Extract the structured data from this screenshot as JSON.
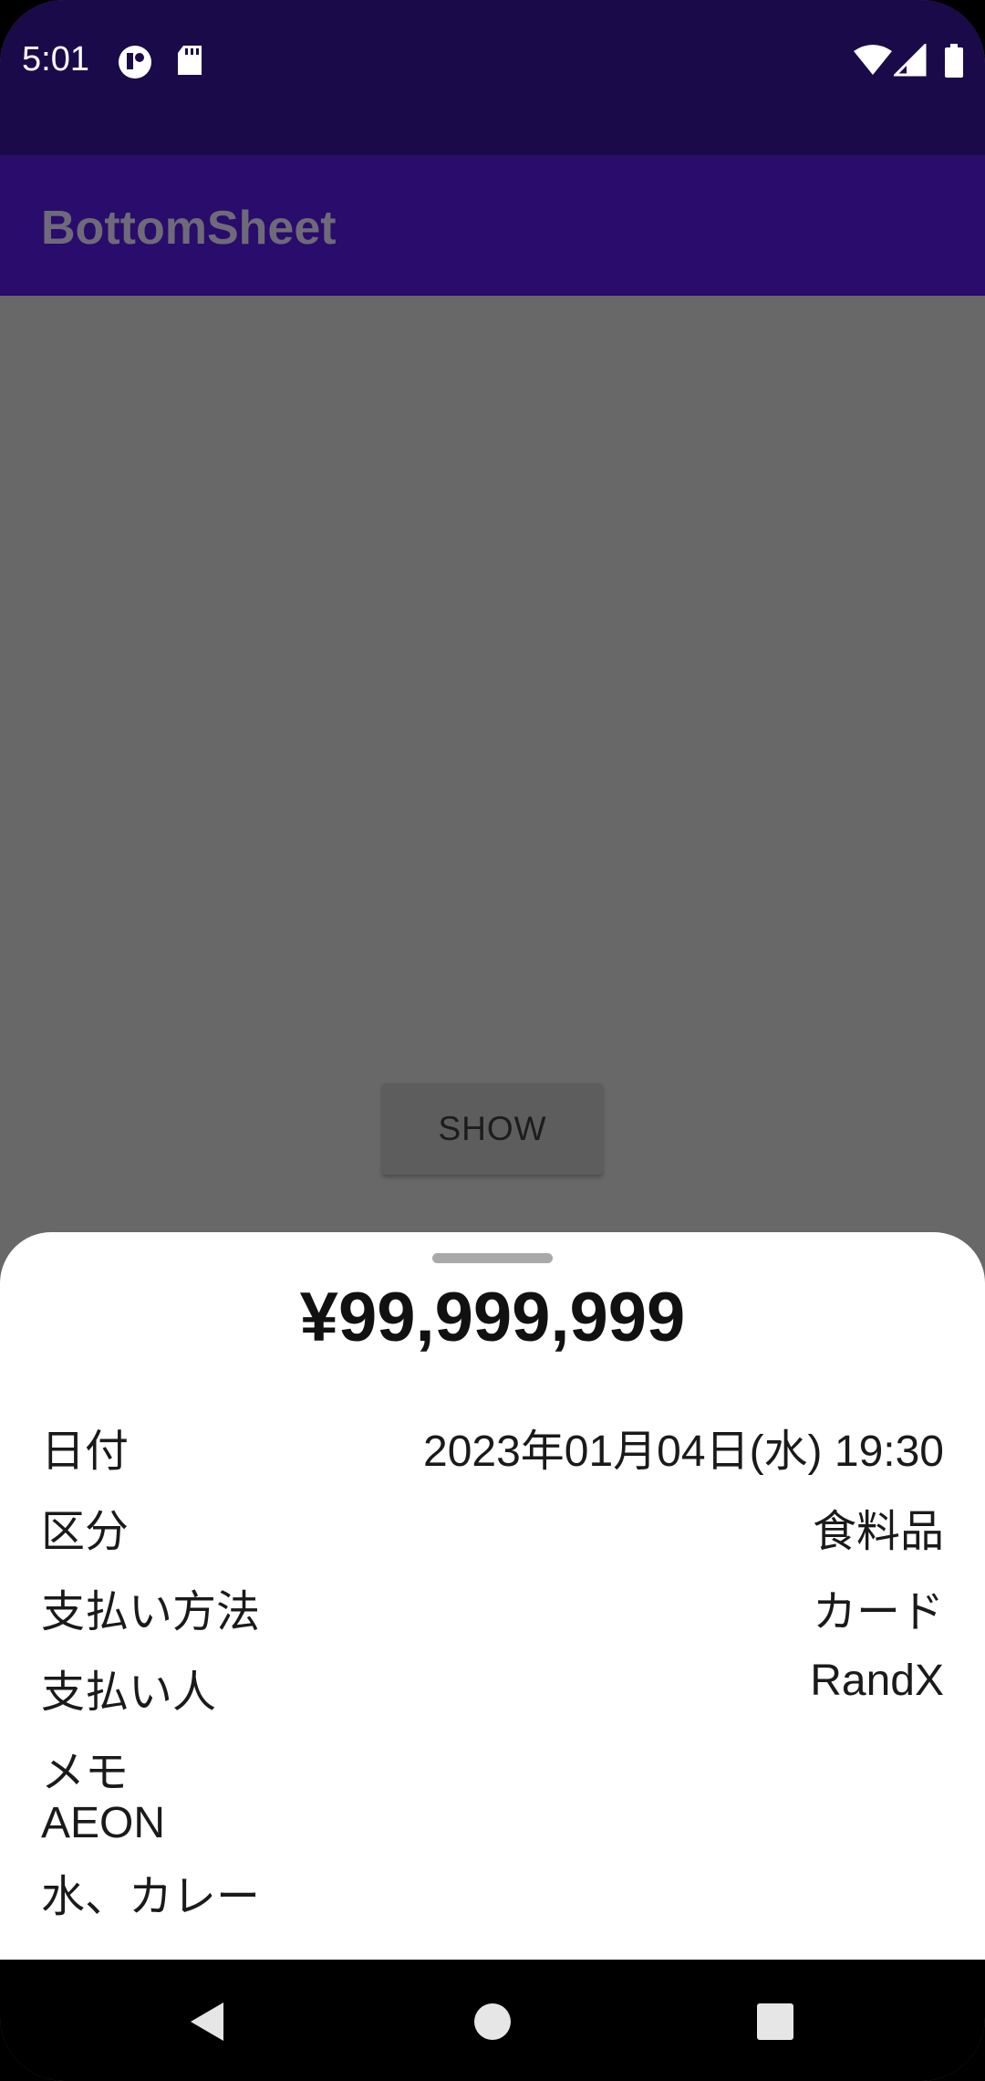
{
  "status_bar": {
    "time": "5:01"
  },
  "app_bar": {
    "title": "BottomSheet"
  },
  "main": {
    "show_button_label": "SHOW"
  },
  "bottom_sheet": {
    "amount": "¥99,999,999",
    "rows": [
      {
        "label": "日付",
        "value": "2023年01月04日(水) 19:30"
      },
      {
        "label": "区分",
        "value": "食料品"
      },
      {
        "label": "支払い方法",
        "value": "カード"
      },
      {
        "label": "支払い人",
        "value": "RandX"
      }
    ],
    "memo_label": "メモ",
    "memo_lines": [
      "AEON",
      "水、カレー"
    ]
  },
  "colors": {
    "status_bar": "#1b0a4a",
    "app_bar": "#290c6b",
    "scrim": "#686868",
    "sheet": "#ffffff"
  }
}
